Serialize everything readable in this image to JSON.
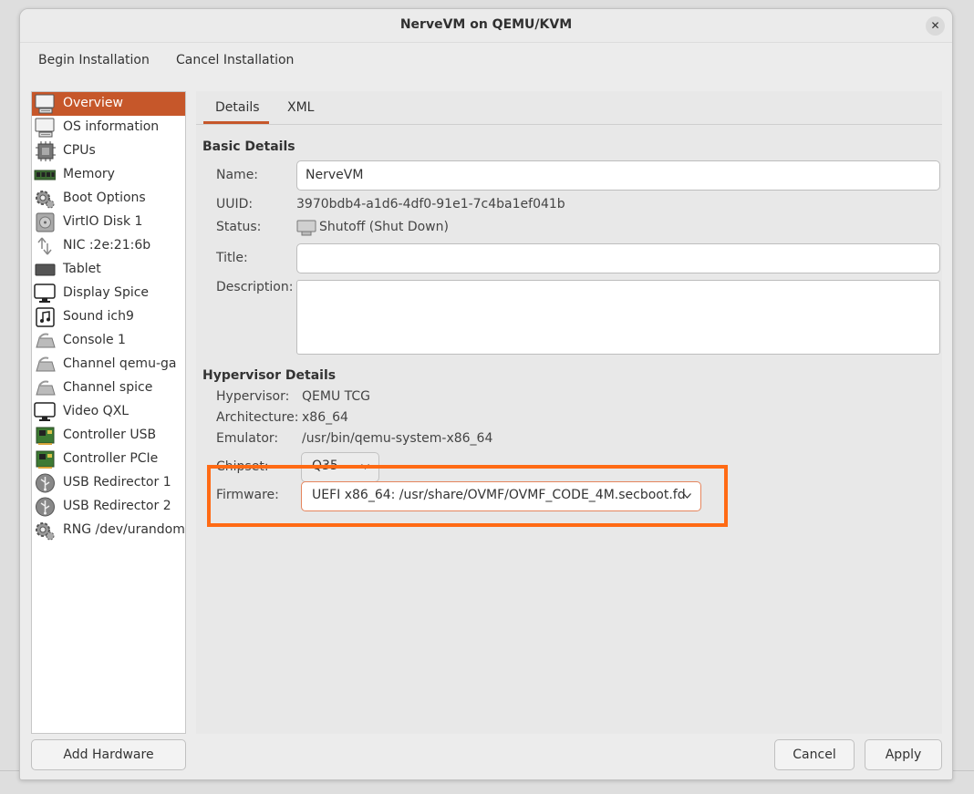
{
  "window": {
    "title": "NerveVM on QEMU/KVM",
    "close_glyph": "✕"
  },
  "toolbar": {
    "begin": "Begin Installation",
    "cancel": "Cancel Installation"
  },
  "sidebar": {
    "items": [
      {
        "label": "Overview",
        "icon": "monitor-icon"
      },
      {
        "label": "OS information",
        "icon": "monitor-icon"
      },
      {
        "label": "CPUs",
        "icon": "cpu-chip-icon"
      },
      {
        "label": "Memory",
        "icon": "memory-icon"
      },
      {
        "label": "Boot Options",
        "icon": "gear-icon"
      },
      {
        "label": "VirtIO Disk 1",
        "icon": "disk-icon"
      },
      {
        "label": "NIC :2e:21:6b",
        "icon": "network-icon"
      },
      {
        "label": "Tablet",
        "icon": "tablet-icon"
      },
      {
        "label": "Display Spice",
        "icon": "display-icon"
      },
      {
        "label": "Sound ich9",
        "icon": "sound-icon"
      },
      {
        "label": "Console 1",
        "icon": "serial-port-icon"
      },
      {
        "label": "Channel qemu-ga",
        "icon": "serial-port-icon"
      },
      {
        "label": "Channel spice",
        "icon": "serial-port-icon"
      },
      {
        "label": "Video QXL",
        "icon": "display-icon"
      },
      {
        "label": "Controller USB",
        "icon": "pci-card-icon"
      },
      {
        "label": "Controller PCIe",
        "icon": "pci-card-icon"
      },
      {
        "label": "USB Redirector 1",
        "icon": "usb-icon"
      },
      {
        "label": "USB Redirector 2",
        "icon": "usb-icon"
      },
      {
        "label": "RNG /dev/urandom",
        "icon": "gear-icon"
      }
    ],
    "add_hardware": "Add Hardware"
  },
  "tabs": {
    "details": "Details",
    "xml": "XML"
  },
  "basic": {
    "heading": "Basic Details",
    "name_label": "Name:",
    "name_value": "NerveVM",
    "uuid_label": "UUID:",
    "uuid_value": "3970bdb4-a1d6-4df0-91e1-7c4ba1ef041b",
    "status_label": "Status:",
    "status_value": "Shutoff (Shut Down)",
    "title_label": "Title:",
    "title_value": "",
    "description_label": "Description:",
    "description_value": ""
  },
  "hypervisor": {
    "heading": "Hypervisor Details",
    "hypervisor_label": "Hypervisor:",
    "hypervisor_value": "QEMU TCG",
    "architecture_label": "Architecture:",
    "architecture_value": "x86_64",
    "emulator_label": "Emulator:",
    "emulator_value": "/usr/bin/qemu-system-x86_64",
    "chipset_label": "Chipset:",
    "chipset_value": "Q35",
    "firmware_label": "Firmware:",
    "firmware_value": "UEFI x86_64: /usr/share/OVMF/OVMF_CODE_4M.secboot.fd"
  },
  "buttons": {
    "cancel": "Cancel",
    "apply": "Apply"
  },
  "colors": {
    "accent": "#c6572a",
    "highlight": "#ff6a14"
  }
}
